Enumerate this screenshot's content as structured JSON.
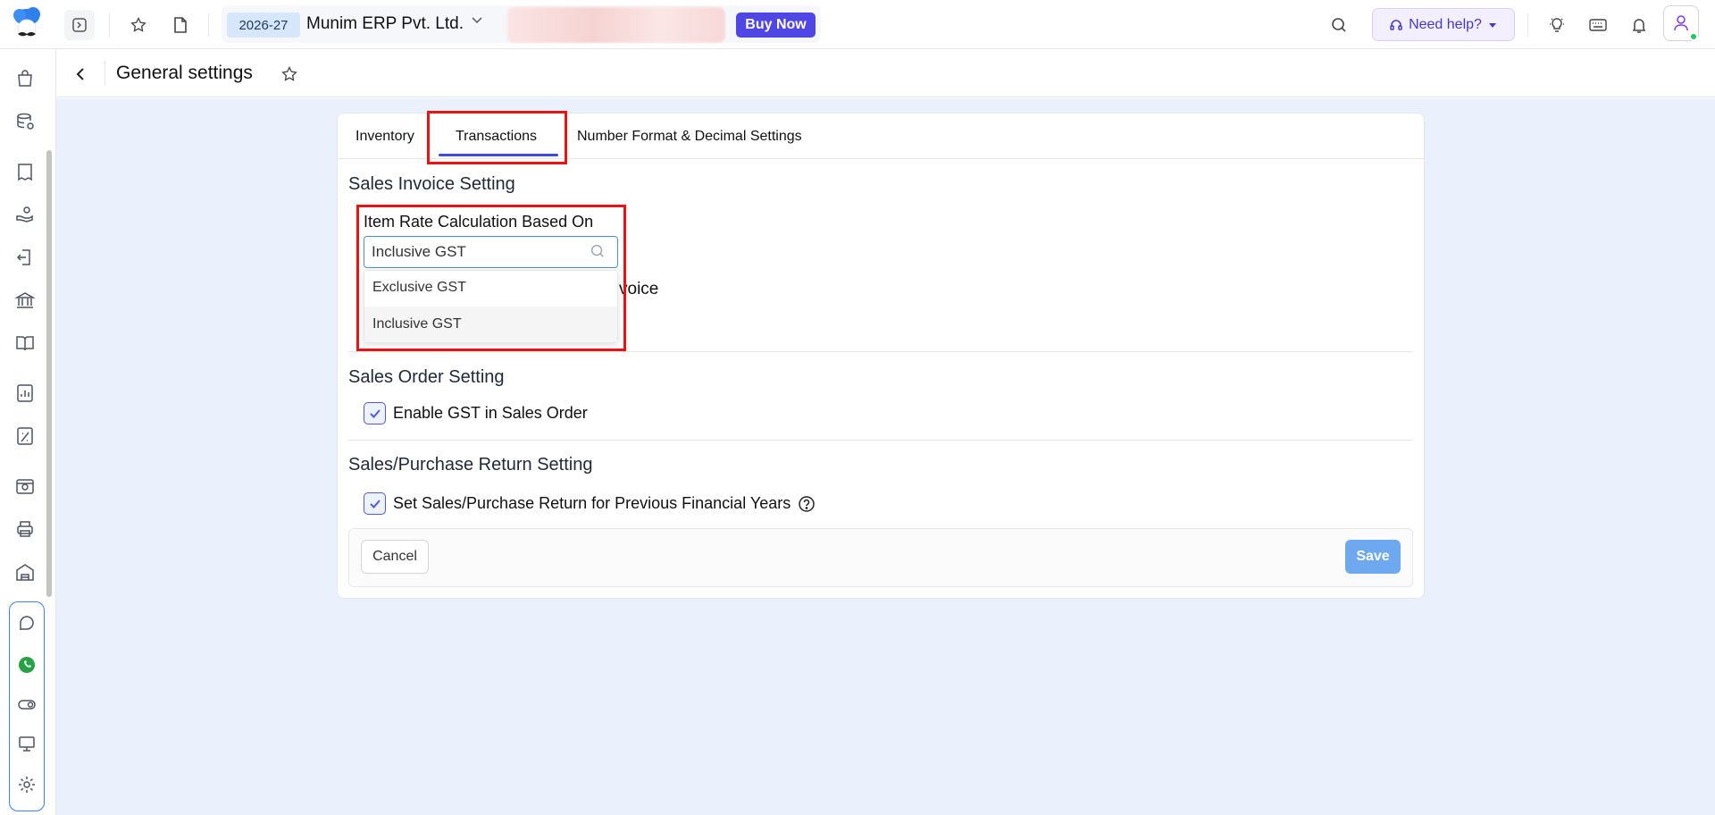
{
  "topbar": {
    "financial_year": "2026-27",
    "company_name": "Munim ERP Pvt. Ltd.",
    "buy_now_label": "Buy Now",
    "need_help_label": "Need help?"
  },
  "page": {
    "title": "General settings"
  },
  "tabs": [
    {
      "label": "Inventory"
    },
    {
      "label": "Transactions"
    },
    {
      "label": "Number Format & Decimal Settings"
    }
  ],
  "sales_invoice": {
    "section_title": "Sales Invoice Setting",
    "field_label": "Item Rate Calculation Based On",
    "input_value": "Inclusive GST",
    "options": [
      "Exclusive GST",
      "Inclusive GST"
    ],
    "hidden_row_fragment": "voice"
  },
  "sales_order": {
    "section_title": "Sales Order Setting",
    "checkbox_label": "Enable GST in Sales Order"
  },
  "return_setting": {
    "section_title": "Sales/Purchase Return Setting",
    "checkbox_label": "Set Sales/Purchase Return for Previous Financial Years"
  },
  "footer": {
    "cancel_label": "Cancel",
    "save_label": "Save"
  },
  "colors": {
    "accent": "#4f46e5",
    "highlight": "#ee1111",
    "save_button": "#6ea8ee",
    "content_background": "#ebf1fc"
  }
}
